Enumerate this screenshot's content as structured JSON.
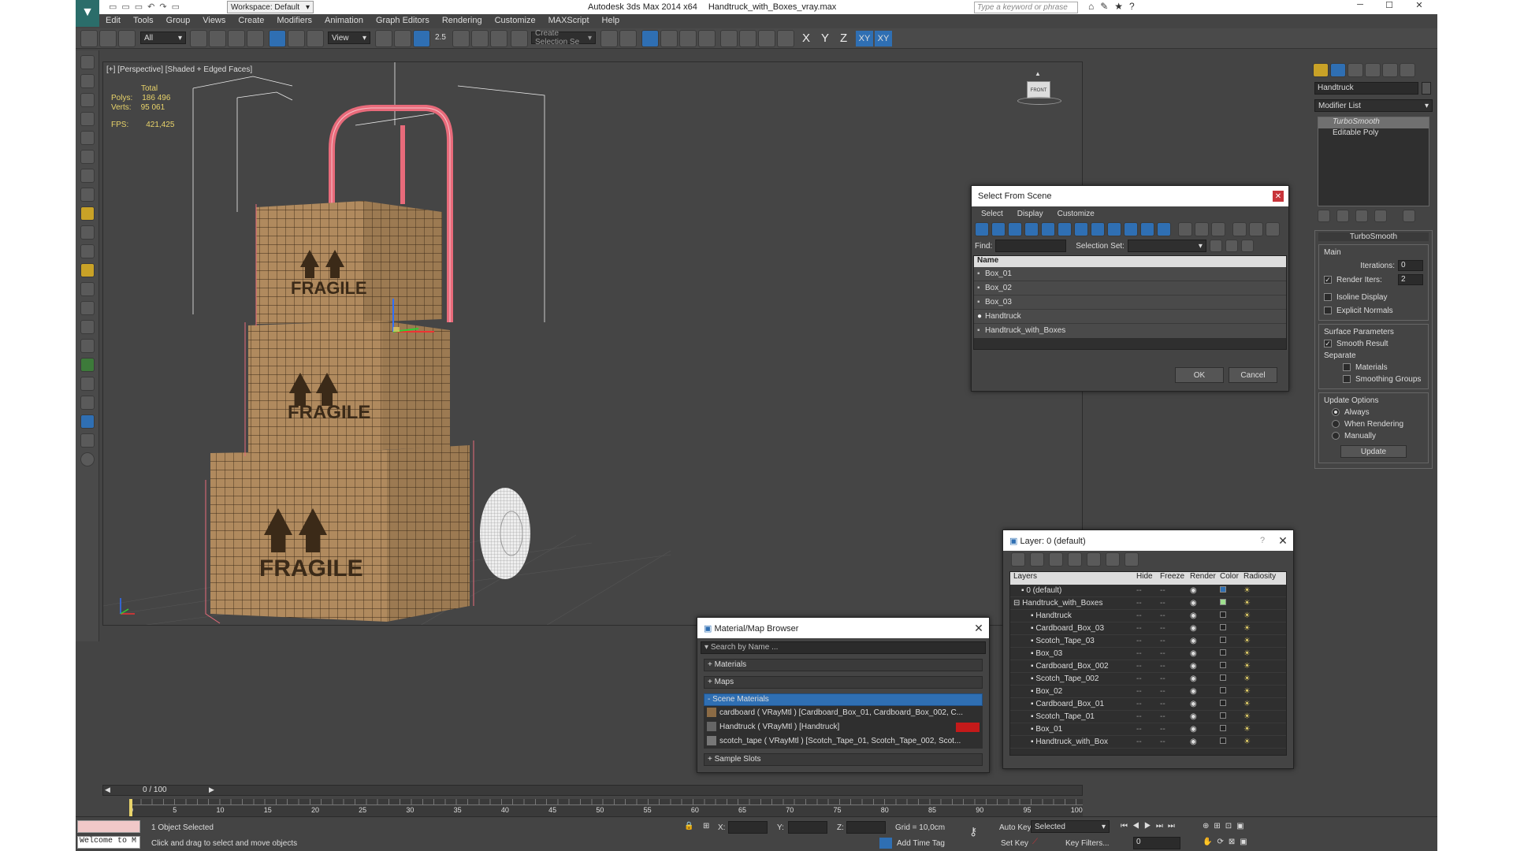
{
  "app": {
    "title": "Autodesk 3ds Max  2014 x64",
    "file": "Handtruck_with_Boxes_vray.max",
    "workspace": "Workspace: Default",
    "search_placeholder": "Type a keyword or phrase"
  },
  "menu": [
    "Edit",
    "Tools",
    "Group",
    "Views",
    "Create",
    "Modifiers",
    "Animation",
    "Graph Editors",
    "Rendering",
    "Customize",
    "MAXScript",
    "Help"
  ],
  "toolbar": {
    "filter": "All",
    "coord": "View",
    "selset": "Create Selection Se",
    "angle": "2.5",
    "axes": [
      "X",
      "Y",
      "Z",
      "XY",
      "XY"
    ]
  },
  "viewport": {
    "label": "[+] [Perspective] [Shaded + Edged Faces]",
    "stats": {
      "total": "Total",
      "polys_label": "Polys:",
      "polys": "186 496",
      "verts_label": "Verts:",
      "verts": "95 061",
      "fps_label": "FPS:",
      "fps": "421,425"
    },
    "box_text": "FRAGILE",
    "viewcube": "FRONT"
  },
  "select_dialog": {
    "title": "Select From Scene",
    "menu": [
      "Select",
      "Display",
      "Customize"
    ],
    "find": "Find:",
    "selset": "Selection Set:",
    "col": "Name",
    "items": [
      "Box_01",
      "Box_02",
      "Box_03",
      "Handtruck",
      "Handtruck_with_Boxes"
    ],
    "ok": "OK",
    "cancel": "Cancel"
  },
  "layer_dialog": {
    "title": "Layer: 0 (default)",
    "help": "?",
    "cols": [
      "Layers",
      "Hide",
      "Freeze",
      "Render",
      "Color",
      "Radiosity"
    ],
    "rows": [
      "0 (default)",
      "Handtruck_with_Boxes",
      "Handtruck",
      "Cardboard_Box_03",
      "Scotch_Tape_03",
      "Box_03",
      "Cardboard_Box_002",
      "Scotch_Tape_002",
      "Box_02",
      "Cardboard_Box_01",
      "Scotch_Tape_01",
      "Box_01",
      "Handtruck_with_Box"
    ]
  },
  "mat_browser": {
    "title": "Material/Map Browser",
    "search": "Search by Name ...",
    "sections": [
      "+ Materials",
      "+ Maps",
      "- Scene Materials",
      "+ Sample Slots"
    ],
    "materials": [
      "cardboard  ( VRayMtl ) [Cardboard_Box_01, Cardboard_Box_002, C...",
      "Handtruck  ( VRayMtl ) [Handtruck]",
      "scotch_tape  ( VRayMtl ) [Scotch_Tape_01, Scotch_Tape_002, Scot..."
    ]
  },
  "cmd_panel": {
    "object": "Handtruck",
    "modlist": "Modifier List",
    "stack": [
      "TurboSmooth",
      "Editable Poly"
    ],
    "rollout": "TurboSmooth",
    "main": "Main",
    "iterations_label": "Iterations:",
    "iterations": "0",
    "render_iters_label": "Render Iters:",
    "render_iters": "2",
    "isoline": "Isoline Display",
    "explicit": "Explicit Normals",
    "surface": "Surface Parameters",
    "smooth_result": "Smooth Result",
    "separate": "Separate",
    "materials": "Materials",
    "smoothing": "Smoothing Groups",
    "update_opts": "Update Options",
    "always": "Always",
    "when_render": "When Rendering",
    "manually": "Manually",
    "update": "Update"
  },
  "timeline": {
    "frame": "0 / 100",
    "ticks": [
      "0",
      "5",
      "10",
      "15",
      "20",
      "25",
      "30",
      "35",
      "40",
      "45",
      "50",
      "55",
      "60",
      "65",
      "70",
      "75",
      "80",
      "85",
      "90",
      "95",
      "100"
    ]
  },
  "status": {
    "maxscript": "Welcome to M",
    "selected": "1 Object Selected",
    "prompt": "Click and drag to select and move objects",
    "x": "X:",
    "y": "Y:",
    "z": "Z:",
    "grid": "Grid = 10,0cm",
    "autokey": "Auto Key",
    "setkey": "Set Key",
    "mode": "Selected",
    "keyfilters": "Key Filters...",
    "addtime": "Add Time Tag",
    "frame": "0"
  }
}
